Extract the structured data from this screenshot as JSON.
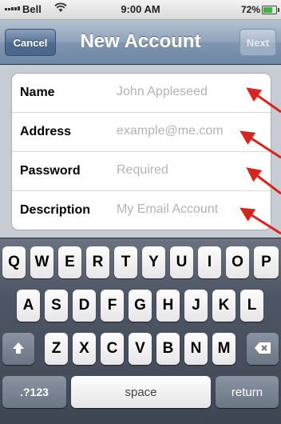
{
  "status_bar": {
    "carrier": "Bell",
    "time": "9:00 AM",
    "battery_percent": "72%",
    "battery_level": 0.72,
    "wifi_icon": "wifi-icon"
  },
  "nav": {
    "cancel_label": "Cancel",
    "title": "New Account",
    "next_label": "Next"
  },
  "form": {
    "fields": [
      {
        "label": "Name",
        "placeholder": "John Appleseed",
        "value": ""
      },
      {
        "label": "Address",
        "placeholder": "example@me.com",
        "value": ""
      },
      {
        "label": "Password",
        "placeholder": "Required",
        "value": ""
      },
      {
        "label": "Description",
        "placeholder": "My Email Account",
        "value": ""
      }
    ]
  },
  "keyboard": {
    "row1": [
      "Q",
      "W",
      "E",
      "R",
      "T",
      "Y",
      "U",
      "I",
      "O",
      "P"
    ],
    "row2": [
      "A",
      "S",
      "D",
      "F",
      "G",
      "H",
      "J",
      "K",
      "L"
    ],
    "row3": [
      "Z",
      "X",
      "C",
      "V",
      "B",
      "N",
      "M"
    ],
    "shift_icon": "shift-arrow-icon",
    "delete_icon": "backspace-icon",
    "numbers_label": ".?123",
    "space_label": "space",
    "return_label": "return"
  },
  "colors": {
    "annotation_arrow": "#d9241b",
    "nav_bar": "#7f95b0",
    "cursor": "#3d78d6"
  }
}
